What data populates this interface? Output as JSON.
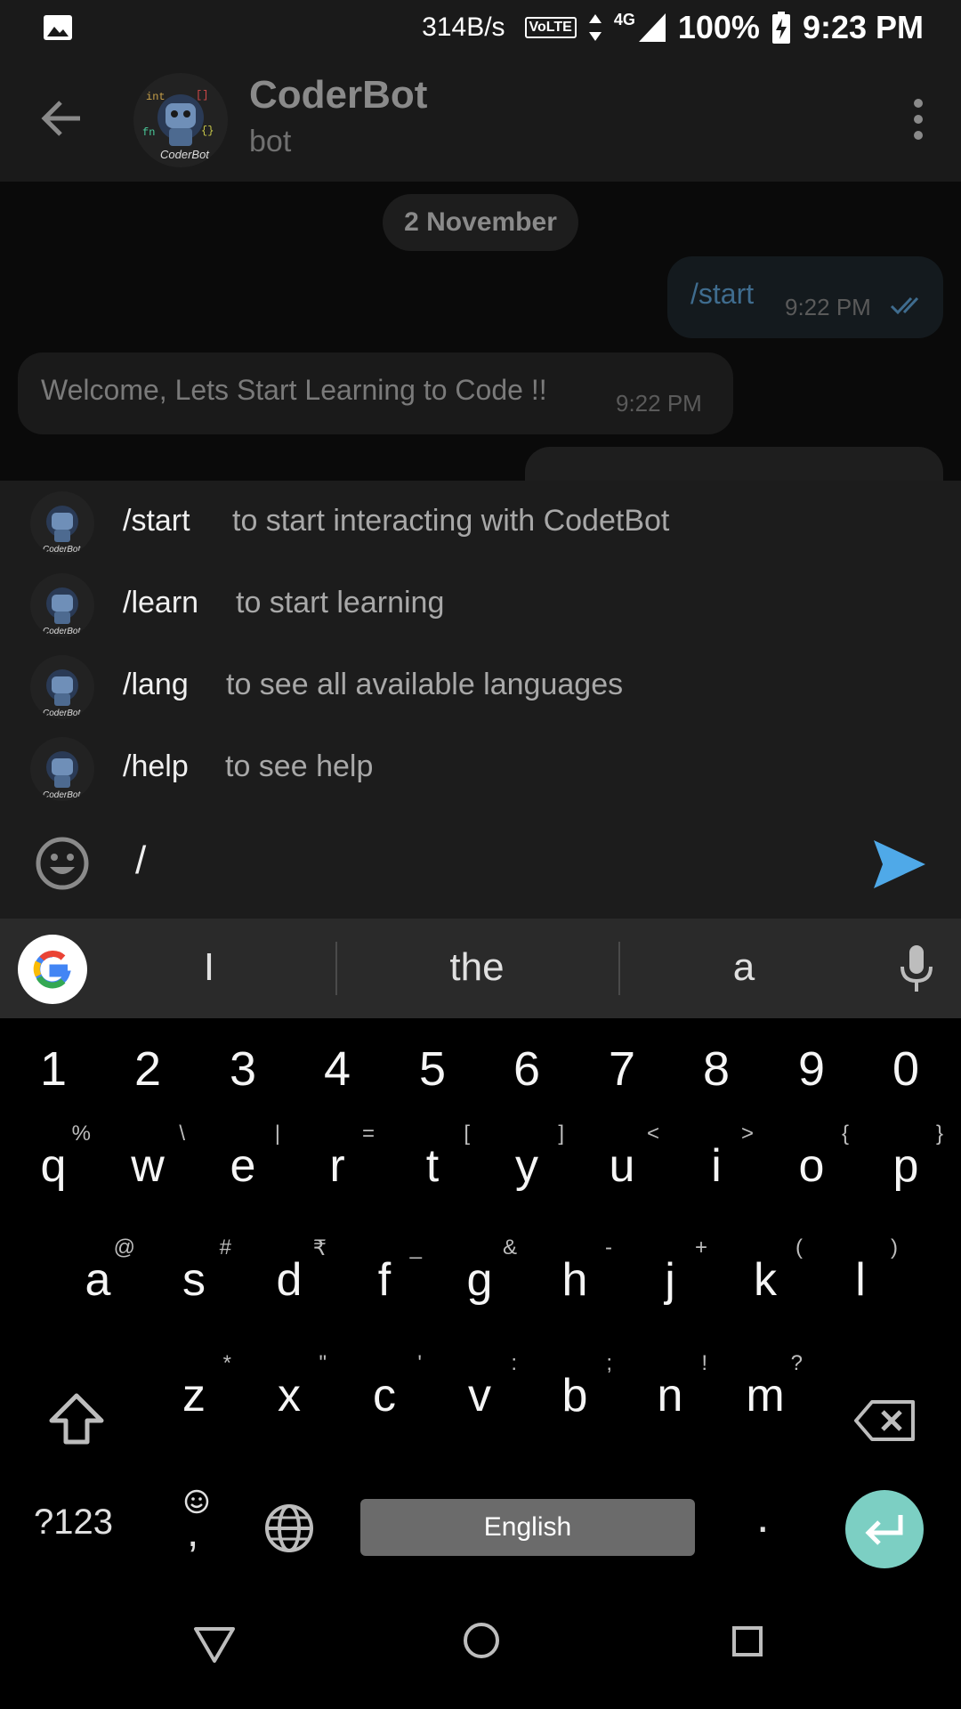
{
  "status_bar": {
    "speed": "314B/s",
    "volte": "VoLTE",
    "network": "4G",
    "battery": "100%",
    "time": "9:23 PM"
  },
  "chat_header": {
    "title": "CoderBot",
    "subtitle": "bot",
    "avatar_text": "CoderBot"
  },
  "messages": {
    "date": "2 November",
    "outgoing": {
      "text": "/start",
      "time": "9:22 PM"
    },
    "incoming": {
      "text": "Welcome, Lets Start Learning to Code !!",
      "time": "9:22 PM"
    }
  },
  "commands": [
    {
      "name": "/start",
      "desc": "to start interacting with CodetBot"
    },
    {
      "name": "/learn",
      "desc": "to start learning"
    },
    {
      "name": "/lang",
      "desc": "to see all available languages"
    },
    {
      "name": "/help",
      "desc": "to see help"
    }
  ],
  "composer": {
    "value": "/"
  },
  "keyboard": {
    "suggestions": [
      "I",
      "the",
      "a"
    ],
    "digits": [
      "1",
      "2",
      "3",
      "4",
      "5",
      "6",
      "7",
      "8",
      "9",
      "0"
    ],
    "row1": [
      {
        "k": "q",
        "h": "%"
      },
      {
        "k": "w",
        "h": "\\"
      },
      {
        "k": "e",
        "h": "|"
      },
      {
        "k": "r",
        "h": "="
      },
      {
        "k": "t",
        "h": "["
      },
      {
        "k": "y",
        "h": "]"
      },
      {
        "k": "u",
        "h": "<"
      },
      {
        "k": "i",
        "h": ">"
      },
      {
        "k": "o",
        "h": "{"
      },
      {
        "k": "p",
        "h": "}"
      }
    ],
    "row2": [
      {
        "k": "a",
        "h": "@"
      },
      {
        "k": "s",
        "h": "#"
      },
      {
        "k": "d",
        "h": "₹"
      },
      {
        "k": "f",
        "h": "_"
      },
      {
        "k": "g",
        "h": "&"
      },
      {
        "k": "h",
        "h": "-"
      },
      {
        "k": "j",
        "h": "+"
      },
      {
        "k": "k",
        "h": "("
      },
      {
        "k": "l",
        "h": ")"
      }
    ],
    "row3": [
      {
        "k": "z",
        "h": "*"
      },
      {
        "k": "x",
        "h": "\""
      },
      {
        "k": "c",
        "h": "'"
      },
      {
        "k": "v",
        "h": ":"
      },
      {
        "k": "b",
        "h": ";"
      },
      {
        "k": "n",
        "h": "!"
      },
      {
        "k": "m",
        "h": "?"
      }
    ],
    "symbols_label": "?123",
    "comma": ",",
    "period": ".",
    "space_label": "English"
  },
  "colors": {
    "accent": "#4fa9e8",
    "enter": "#7ccfc3"
  }
}
